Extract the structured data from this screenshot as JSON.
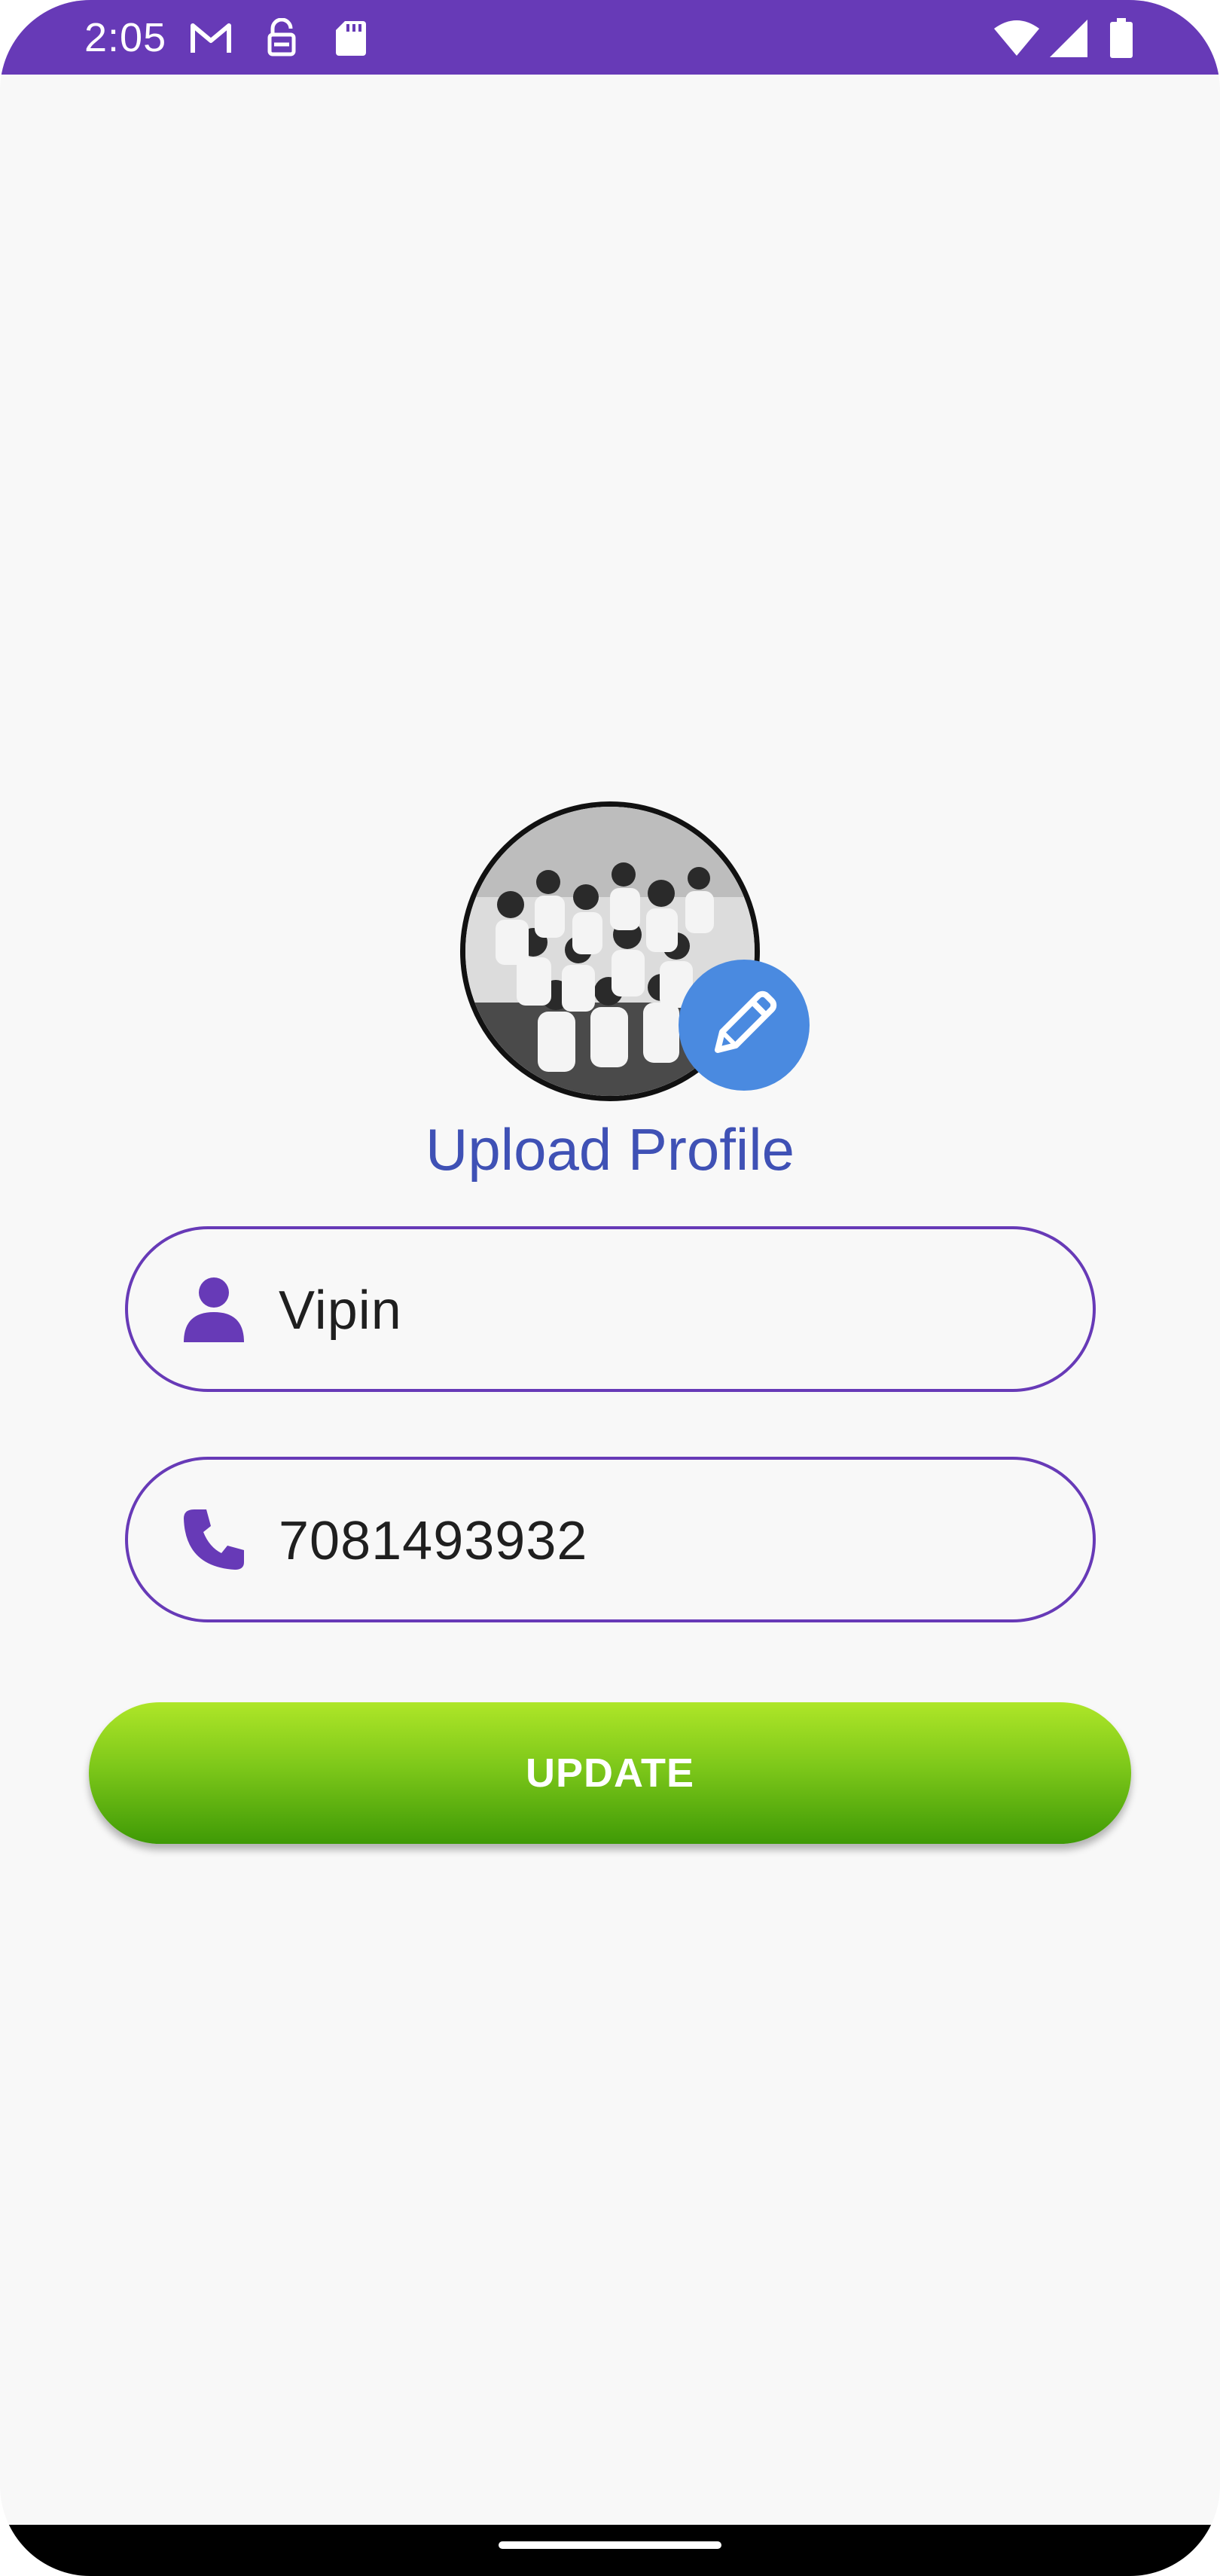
{
  "status_bar": {
    "time": "2:05",
    "icons": [
      "gmail-icon",
      "sim-unlock-icon",
      "sd-card-icon",
      "wifi-icon",
      "signal-icon",
      "battery-icon"
    ],
    "background": "#673ab7"
  },
  "profile": {
    "avatar_icon": "group-photo",
    "edit_icon": "pencil-icon",
    "title": "Upload Profile"
  },
  "form": {
    "name": {
      "icon": "person-icon",
      "value": "Vipin"
    },
    "phone": {
      "icon": "phone-icon",
      "value": "7081493932"
    }
  },
  "update_button": {
    "label": "UPDATE"
  },
  "colors": {
    "accent": "#673ab7",
    "title": "#3f51b5",
    "edit_badge": "#4a8ae0",
    "button_top": "#aee628",
    "button_bottom": "#3f9a06"
  }
}
